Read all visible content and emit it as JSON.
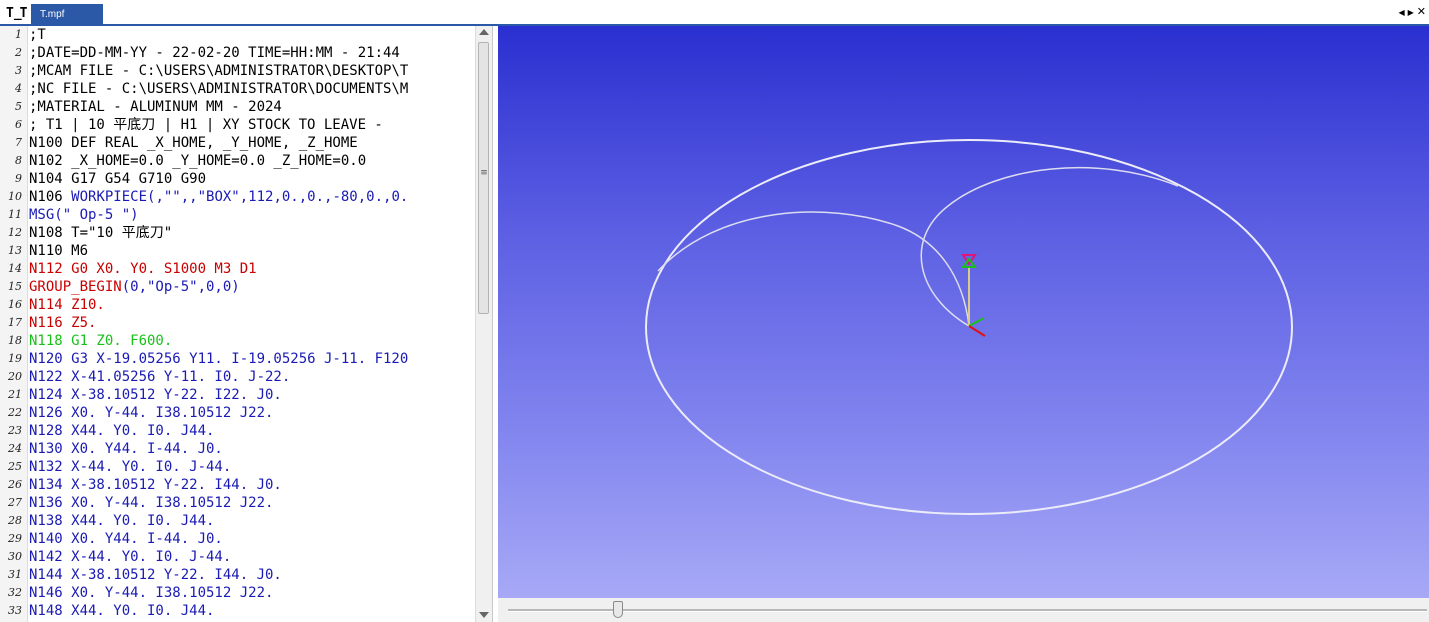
{
  "tab": {
    "app_icon": "T̲T",
    "active_label": "T.mpf",
    "nav": {
      "prev": "◀",
      "next": "▶",
      "close": "✕"
    }
  },
  "editor": {
    "lines": [
      {
        "n": "1",
        "text": ";T",
        "color": "black"
      },
      {
        "n": "2",
        "text": ";DATE=DD-MM-YY - 22-02-20 TIME=HH:MM - 21:44",
        "color": "black"
      },
      {
        "n": "3",
        "text": ";MCAM FILE - C:\\USERS\\ADMINISTRATOR\\DESKTOP\\T",
        "color": "black"
      },
      {
        "n": "4",
        "text": ";NC FILE - C:\\USERS\\ADMINISTRATOR\\DOCUMENTS\\M",
        "color": "black"
      },
      {
        "n": "5",
        "text": ";MATERIAL - ALUMINUM MM - 2024",
        "color": "black"
      },
      {
        "n": "6",
        "text": "; T1 | 10 平底刀 | H1 | XY STOCK TO LEAVE - ",
        "color": "black"
      },
      {
        "n": "7",
        "text": "N100 DEF REAL _X_HOME, _Y_HOME, _Z_HOME",
        "color": "black"
      },
      {
        "n": "8",
        "text": "N102 _X_HOME=0.0 _Y_HOME=0.0 _Z_HOME=0.0",
        "color": "black"
      },
      {
        "n": "9",
        "text": "N104 G17 G54 G710 G90",
        "color": "black"
      },
      {
        "n": "10",
        "text": "N106 WORKPIECE(,\"\",,\"BOX\",112,0.,0.,-80,0.,0.",
        "color": "mixed",
        "prefix": "N106 ",
        "rest": "WORKPIECE(,\"\",,\"BOX\",112,0.,0.,-80,0.,0."
      },
      {
        "n": "11",
        "text": "MSG(\" Op-5 \")",
        "color": "blue"
      },
      {
        "n": "12",
        "text": "N108 T=\"10 平底刀\"",
        "color": "black"
      },
      {
        "n": "13",
        "text": "N110 M6",
        "color": "black"
      },
      {
        "n": "14",
        "text": "N112 G0 X0. Y0. S1000 M3 D1",
        "color": "red"
      },
      {
        "n": "15",
        "text": "GROUP_BEGIN(0,\"Op-5\",0,0)",
        "color": "mixed2",
        "prefix": "GROUP_BEGIN",
        "rest": "(0,\"Op-5\",0,0)"
      },
      {
        "n": "16",
        "text": "N114 Z10.",
        "color": "red"
      },
      {
        "n": "17",
        "text": "N116 Z5.",
        "color": "red"
      },
      {
        "n": "18",
        "text": "N118 G1 Z0. F600.",
        "color": "green"
      },
      {
        "n": "19",
        "text": "N120 G3 X-19.05256 Y11. I-19.05256 J-11. F120",
        "color": "blue"
      },
      {
        "n": "20",
        "text": "N122 X-41.05256 Y-11. I0. J-22.",
        "color": "blue"
      },
      {
        "n": "21",
        "text": "N124 X-38.10512 Y-22. I22. J0.",
        "color": "blue"
      },
      {
        "n": "22",
        "text": "N126 X0. Y-44. I38.10512 J22.",
        "color": "blue"
      },
      {
        "n": "23",
        "text": "N128 X44. Y0. I0. J44.",
        "color": "blue"
      },
      {
        "n": "24",
        "text": "N130 X0. Y44. I-44. J0.",
        "color": "blue"
      },
      {
        "n": "25",
        "text": "N132 X-44. Y0. I0. J-44.",
        "color": "blue"
      },
      {
        "n": "26",
        "text": "N134 X-38.10512 Y-22. I44. J0.",
        "color": "blue"
      },
      {
        "n": "27",
        "text": "N136 X0. Y-44. I38.10512 J22.",
        "color": "blue"
      },
      {
        "n": "28",
        "text": "N138 X44. Y0. I0. J44.",
        "color": "blue"
      },
      {
        "n": "29",
        "text": "N140 X0. Y44. I-44. J0.",
        "color": "blue"
      },
      {
        "n": "30",
        "text": "N142 X-44. Y0. I0. J-44.",
        "color": "blue"
      },
      {
        "n": "31",
        "text": "N144 X-38.10512 Y-22. I44. J0.",
        "color": "blue"
      },
      {
        "n": "32",
        "text": "N146 X0. Y-44. I38.10512 J22.",
        "color": "blue"
      },
      {
        "n": "33",
        "text": "N148 X44. Y0. I0. J44.",
        "color": "blue"
      }
    ]
  },
  "colors": {
    "tab_accent": "#2b59a7",
    "code_black": "#000000",
    "code_blue": "#1a1ab4",
    "code_red": "#c80000",
    "code_green": "#19c019",
    "toolpath": "#e8e8f4",
    "viewport_top": "#2a2fd0",
    "viewport_bottom": "#a7a9f6"
  },
  "simulation": {
    "playback_progress": 0.12
  }
}
